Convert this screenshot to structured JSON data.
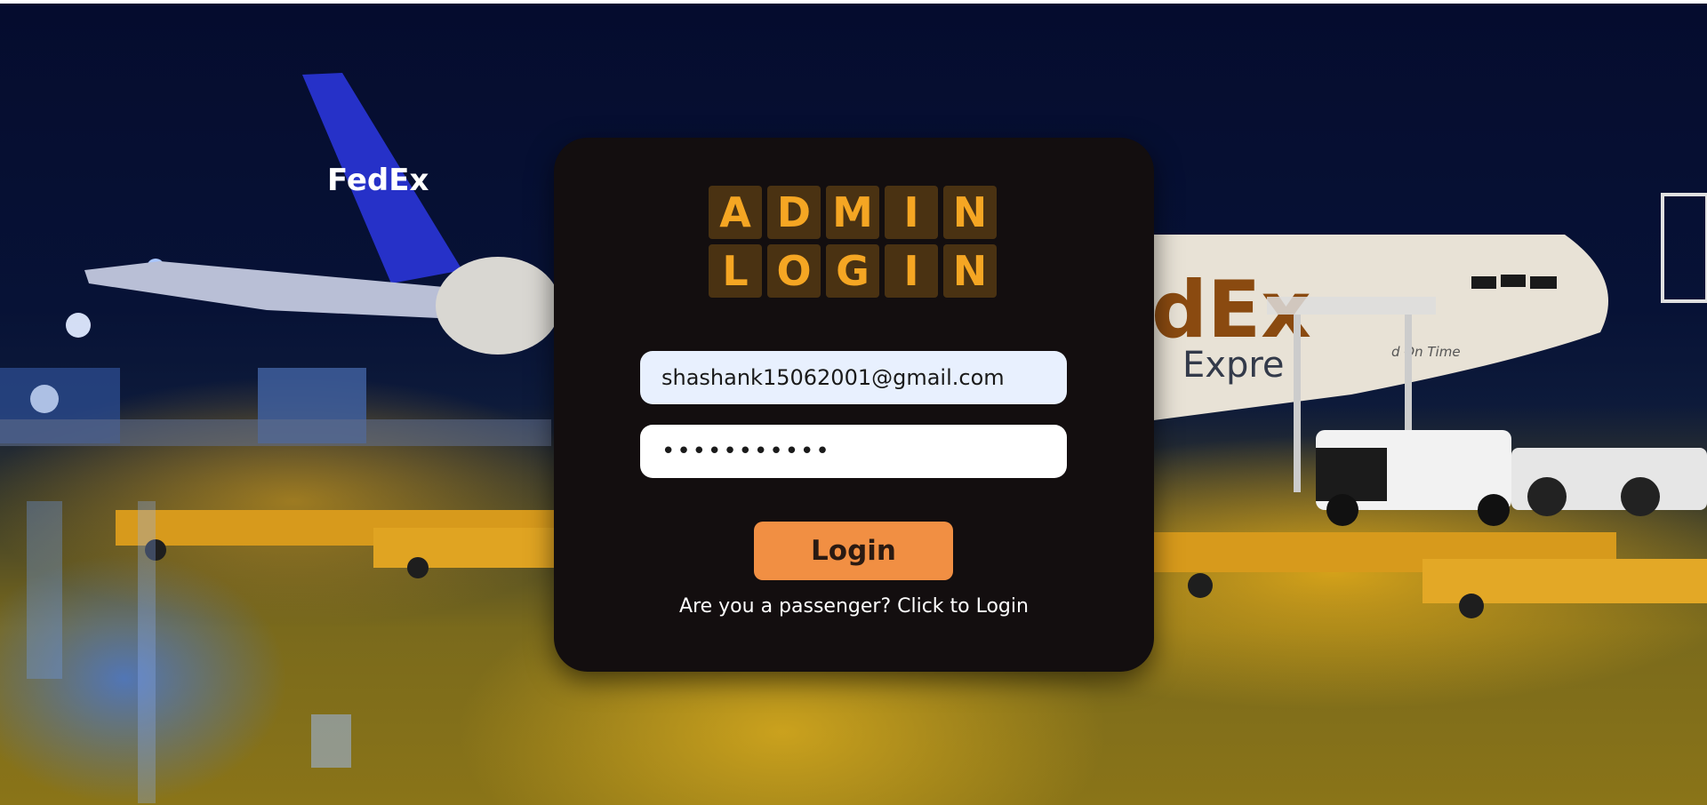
{
  "title_tiles": {
    "row1": [
      "A",
      "D",
      "M",
      "I",
      "N"
    ],
    "row2": [
      "L",
      "O",
      "G",
      "I",
      "N"
    ]
  },
  "form": {
    "email_value": "shashank15062001@gmail.com",
    "password_value": "•••••••••••",
    "login_label": "Login",
    "passenger_link": "Are you a passenger? Click to Login"
  },
  "background": {
    "airline_logo_tail": "FedEx",
    "airline_logo_fuselage": "dEx",
    "fuselage_text": "Expre",
    "fuselage_slogan": "d On Time"
  },
  "colors": {
    "card": "#130e0f",
    "tile": "#4a3212",
    "tile_text": "#f5a623",
    "button": "#f18f43"
  }
}
